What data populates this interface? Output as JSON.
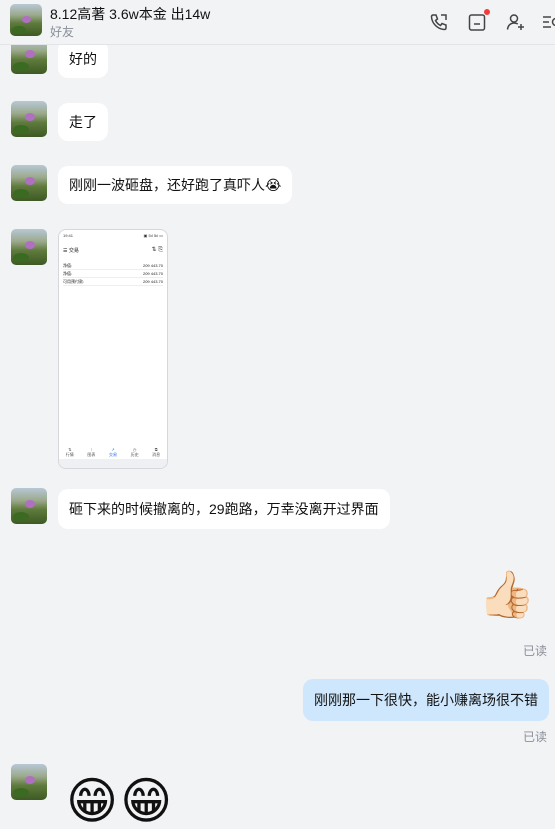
{
  "header": {
    "title": "8.12高著 3.6w本金 出14w",
    "subtitle": "好友",
    "icons": [
      "call-icon",
      "file-icon",
      "add-user-icon",
      "more-icon"
    ]
  },
  "messages": [
    {
      "side": "left",
      "type": "text",
      "text": "好的"
    },
    {
      "side": "left",
      "type": "text",
      "text": "走了"
    },
    {
      "side": "left",
      "type": "text",
      "text": "刚刚一波砸盘，还好跑了真吓人",
      "emoji": "😭"
    },
    {
      "side": "left",
      "type": "image"
    },
    {
      "side": "left",
      "type": "text",
      "text": "砸下来的时候撤离的，29跑路，万幸没离开过界面"
    },
    {
      "side": "right",
      "type": "emoji",
      "text": "👍🏻",
      "read": "已读"
    },
    {
      "side": "right",
      "type": "text",
      "text": "刚刚那一下很快，能小赚离场很不错",
      "read": "已读"
    },
    {
      "side": "left",
      "type": "emoji",
      "text": "😁😁"
    }
  ],
  "screenshot": {
    "status_time": "19:41",
    "status_right": "▣ 5ıl 5ıl ▭",
    "nav_title": "☰  交易",
    "nav_icons": "⇅  ⎘",
    "rows": [
      {
        "label": "净值:",
        "value": "209 443.70"
      },
      {
        "label": "净值:",
        "value": "209 443.70"
      },
      {
        "label": "可用预付款:",
        "value": "209 443.70"
      }
    ],
    "tabs": [
      "行情",
      "图表",
      "交易",
      "历史",
      "消息"
    ]
  },
  "colors": {
    "background": "#f2f3f5",
    "my_bubble": "#cfe7fc",
    "their_bubble": "#ffffff",
    "badge": "#f23c3c"
  }
}
